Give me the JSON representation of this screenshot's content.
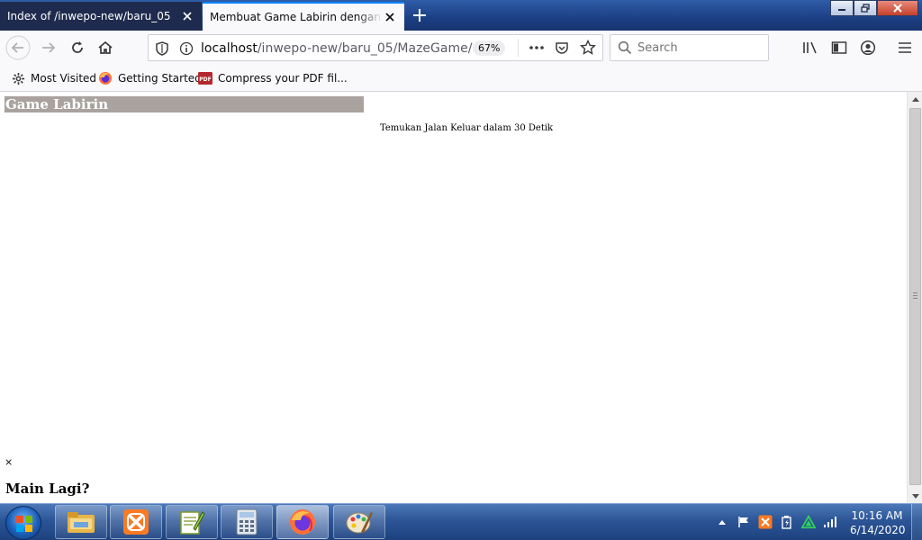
{
  "browser": {
    "tabs": [
      {
        "title": "Index of /inwepo-new/baru_05",
        "active": false
      },
      {
        "title": "Membuat Game Labirin dengan Jav",
        "active": true
      }
    ],
    "url": {
      "host": "localhost",
      "path": "/inwepo-new/baru_05/MazeGame/"
    },
    "zoom": "67%",
    "search_placeholder": "Search",
    "bookmarks": [
      {
        "label": "Most Visited",
        "icon": "gear-icon"
      },
      {
        "label": "Getting Started",
        "icon": "firefox-icon"
      },
      {
        "label": "Compress your PDF fil...",
        "icon": "pdf-icon"
      }
    ],
    "accent_color": "#0a84ff"
  },
  "page": {
    "game_title": "Game Labirin",
    "instruction": "Temukan Jalan Keluar dalam 30 Detik",
    "close_symbol": "×",
    "play_again": "Main Lagi?",
    "title_bar_color": "#a9a29f"
  },
  "taskbar": {
    "apps": [
      "file-explorer-icon",
      "xampp-icon",
      "notepad-plus-icon",
      "calculator-icon",
      "firefox-icon",
      "paint-icon"
    ],
    "active_app": "firefox-icon",
    "tray_icons": [
      "show-hidden-icons",
      "flag-icon",
      "xampp-tray-icon",
      "power-icon",
      "network-icon",
      "signal-icon"
    ],
    "time": "10:16 AM",
    "date": "6/14/2020"
  }
}
